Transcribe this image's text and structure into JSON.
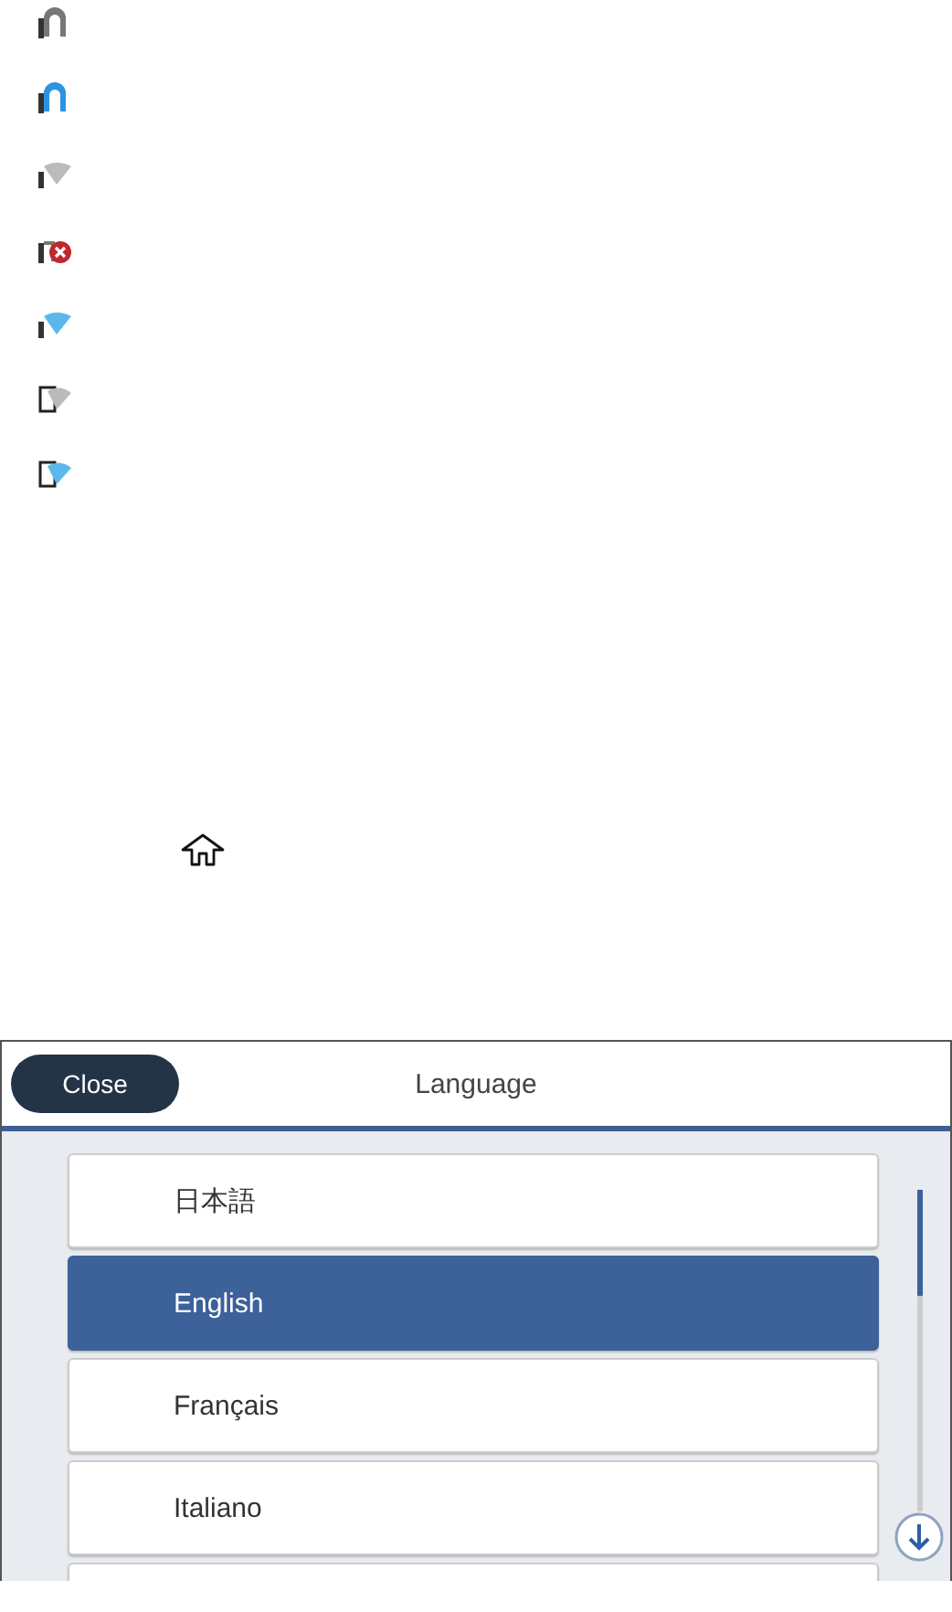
{
  "status_icons": [
    {
      "kind": "wired_off"
    },
    {
      "kind": "wired_on"
    },
    {
      "kind": "wifi_off"
    },
    {
      "kind": "error"
    },
    {
      "kind": "wifi_on"
    },
    {
      "kind": "direct_off"
    },
    {
      "kind": "direct_on"
    }
  ],
  "home_icon": {
    "kind": "home"
  },
  "panel": {
    "close_button": "Close",
    "title": "Language",
    "items": [
      {
        "label": "日本語",
        "selected": false
      },
      {
        "label": "English",
        "selected": true
      },
      {
        "label": "Français",
        "selected": false
      },
      {
        "label": "Italiano",
        "selected": false
      }
    ]
  }
}
